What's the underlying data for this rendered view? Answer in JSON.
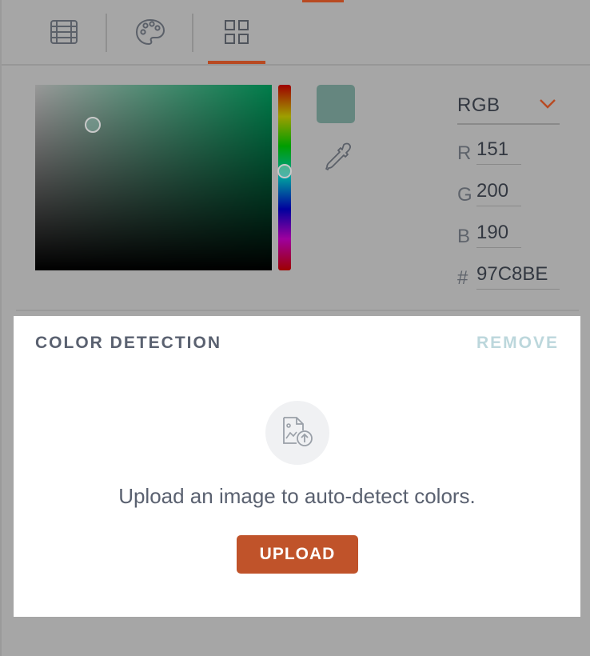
{
  "tabs": [
    {
      "name": "table-tab",
      "icon": "table-grid-icon",
      "active": false
    },
    {
      "name": "palette-tab",
      "icon": "palette-icon",
      "active": false
    },
    {
      "name": "grid-tab",
      "icon": "four-squares-icon",
      "active": true
    }
  ],
  "picker": {
    "selected_color": "#97C8BE",
    "mode": "RGB",
    "channels": [
      {
        "label": "R",
        "value": "151"
      },
      {
        "label": "G",
        "value": "200"
      },
      {
        "label": "B",
        "value": "190"
      },
      {
        "label": "#",
        "value": "97C8BE"
      }
    ]
  },
  "detection": {
    "title": "COLOR DETECTION",
    "remove_label": "REMOVE",
    "message": "Upload an image to auto-detect colors.",
    "upload_label": "UPLOAD",
    "icon": "image-upload-icon"
  },
  "colors": {
    "accent": "#c0532a",
    "overlay": "#a6a6a6",
    "text_dark": "#5a6170"
  }
}
